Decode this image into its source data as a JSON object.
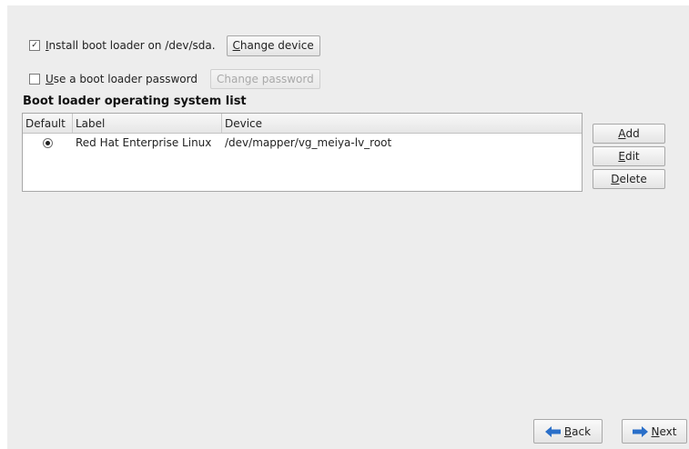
{
  "bootloader": {
    "install_checkbox": {
      "checked_glyph": "☑",
      "label_accel": "I",
      "label_rest": "nstall boot loader on /dev/sda.",
      "button_accel": "C",
      "button_rest": "hange device"
    },
    "password_checkbox": {
      "checked_glyph": "☐",
      "label_accel": "U",
      "label_rest": "se a boot loader password",
      "button_label": "Change password",
      "button_enabled": false
    }
  },
  "os_list": {
    "title": "Boot loader operating system list",
    "columns": [
      "Default",
      "Label",
      "Device"
    ],
    "rows": [
      {
        "default_selected": true,
        "label": "Red Hat Enterprise Linux",
        "device": "/dev/mapper/vg_meiya-lv_root"
      }
    ]
  },
  "actions": {
    "add": {
      "accel": "A",
      "rest": "dd"
    },
    "edit": {
      "accel": "E",
      "rest": "dit"
    },
    "delete": {
      "accel": "D",
      "rest": "elete"
    }
  },
  "navigation": {
    "back": {
      "accel": "B",
      "rest": "ack",
      "icon": "arrow-left-icon"
    },
    "next": {
      "accel": "N",
      "rest": "ext",
      "icon": "arrow-right-icon"
    }
  },
  "colors": {
    "panel_background": "#ededed",
    "arrow_blue": "#2a6fc9"
  }
}
